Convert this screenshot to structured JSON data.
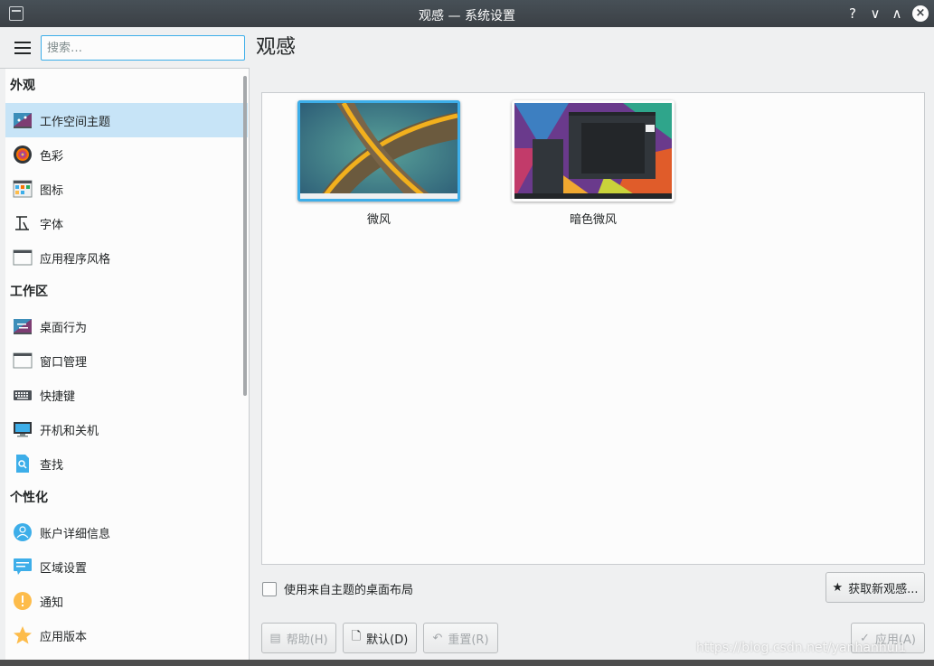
{
  "window": {
    "title": "观感 — 系统设置",
    "controls": {
      "help": "?",
      "minimize": "∨",
      "maximize": "∧",
      "close": "×"
    }
  },
  "search": {
    "placeholder": "搜索…"
  },
  "sidebar": {
    "sections": [
      {
        "header": "外观",
        "items": [
          {
            "label": "工作空间主题",
            "icon": "workspace-theme-icon",
            "selected": true
          },
          {
            "label": "色彩",
            "icon": "colors-icon"
          },
          {
            "label": "图标",
            "icon": "icons-icon"
          },
          {
            "label": "字体",
            "icon": "fonts-icon"
          },
          {
            "label": "应用程序风格",
            "icon": "app-style-icon"
          }
        ]
      },
      {
        "header": "工作区",
        "items": [
          {
            "label": "桌面行为",
            "icon": "desktop-behavior-icon"
          },
          {
            "label": "窗口管理",
            "icon": "window-management-icon"
          },
          {
            "label": "快捷键",
            "icon": "keyboard-icon"
          },
          {
            "label": "开机和关机",
            "icon": "startup-shutdown-icon"
          },
          {
            "label": "查找",
            "icon": "search-file-icon"
          }
        ]
      },
      {
        "header": "个性化",
        "items": [
          {
            "label": "账户详细信息",
            "icon": "user-account-icon"
          },
          {
            "label": "区域设置",
            "icon": "locale-icon"
          },
          {
            "label": "通知",
            "icon": "notification-icon"
          },
          {
            "label": "应用版本",
            "icon": "star-icon"
          }
        ]
      }
    ]
  },
  "main": {
    "title": "观感",
    "themes": [
      {
        "name": "微风",
        "selected": true
      },
      {
        "name": "暗色微风",
        "selected": false
      }
    ],
    "use_layout_label": "使用来自主题的桌面布局",
    "get_new_label": "获取新观感...",
    "buttons": {
      "help": "帮助(H)",
      "defaults": "默认(D)",
      "reset": "重置(R)",
      "apply": "应用(A)"
    }
  },
  "watermark": "https://blog.csdn.net/yanhanhui1",
  "colors": {
    "accent": "#3daee9",
    "selected_row": "#c7e4f7",
    "titlebar": "#3b4045"
  }
}
